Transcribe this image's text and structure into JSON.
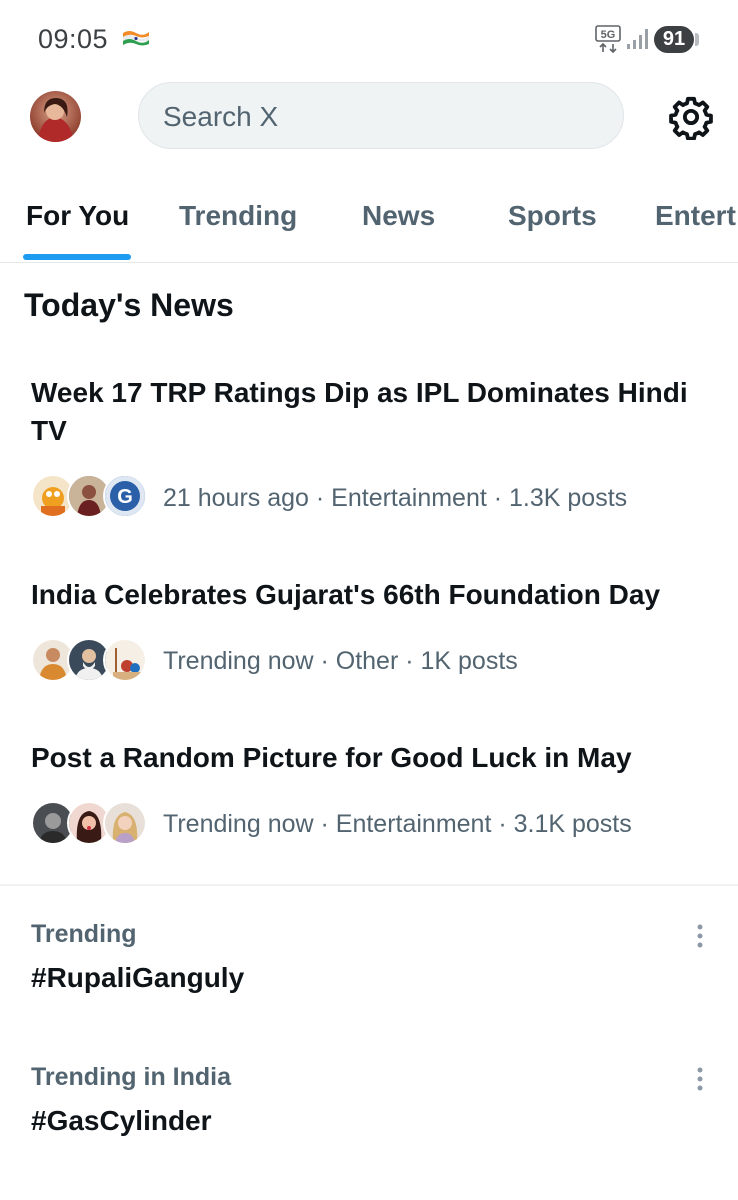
{
  "status_bar": {
    "time": "09:05",
    "network": "5G",
    "battery": "91",
    "icons": [
      "india-flag-icon",
      "network-5g-icon",
      "signal-icon",
      "battery-icon"
    ]
  },
  "header": {
    "search_placeholder": "Search X",
    "icons": [
      "avatar",
      "settings-gear-icon"
    ]
  },
  "tabs": [
    {
      "label": "For You",
      "active": true
    },
    {
      "label": "Trending",
      "active": false
    },
    {
      "label": "News",
      "active": false
    },
    {
      "label": "Sports",
      "active": false
    },
    {
      "label": "Entert",
      "active": false
    }
  ],
  "todays_news": {
    "title": "Today's News",
    "items": [
      {
        "title": "Week 17 TRP Ratings Dip as IPL Dominates Hindi TV",
        "meta": "21 hours ago · Entertainment · 1.3K posts"
      },
      {
        "title": "India Celebrates Gujarat's 66th Foundation Day",
        "meta": "Trending now · Other · 1K posts"
      },
      {
        "title": "Post a Random Picture for Good Luck in May",
        "meta": "Trending now · Entertainment · 3.1K posts"
      }
    ]
  },
  "trends": [
    {
      "context": "Trending",
      "name": "#RupaliGanguly"
    },
    {
      "context": "Trending in India",
      "name": "#GasCylinder"
    }
  ],
  "colors": {
    "accent": "#1d9bf0",
    "text_primary": "#0f1419",
    "text_secondary": "#536471",
    "search_bg": "#eff3f4"
  }
}
